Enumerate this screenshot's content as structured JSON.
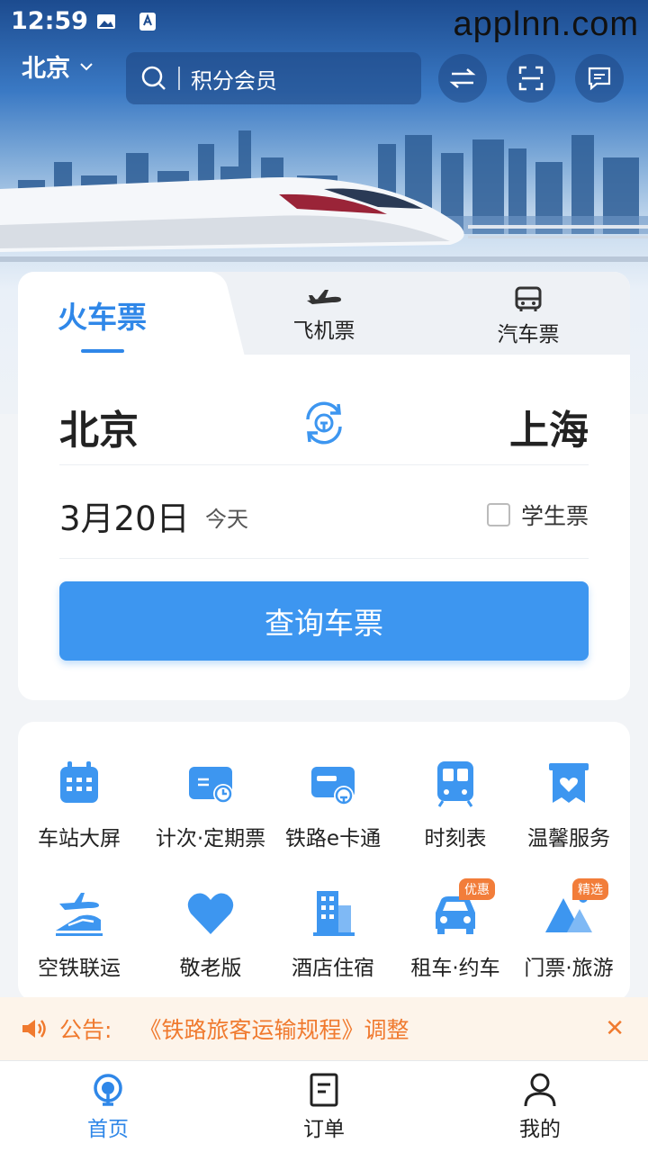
{
  "status_bar": {
    "time": "12:59",
    "watermark": "applnn.com"
  },
  "header": {
    "city": "北京",
    "search_placeholder": "积分会员"
  },
  "ticket_tabs": [
    {
      "label": "火车票",
      "icon": "train-icon"
    },
    {
      "label": "飞机票",
      "icon": "plane-icon"
    },
    {
      "label": "汽车票",
      "icon": "bus-icon"
    }
  ],
  "ticket": {
    "from": "北京",
    "to": "上海",
    "date": "3月20日",
    "day_label": "今天",
    "student_label": "学生票",
    "student_checked": false,
    "query_label": "查询车票"
  },
  "services": [
    {
      "label": "车站大屏",
      "icon": "calendar-icon"
    },
    {
      "label": "计次·定期票",
      "icon": "ticket-card-icon"
    },
    {
      "label": "铁路e卡通",
      "icon": "e-card-icon"
    },
    {
      "label": "时刻表",
      "icon": "timetable-icon"
    },
    {
      "label": "温馨服务",
      "icon": "heart-bag-icon"
    },
    {
      "label": "空铁联运",
      "icon": "air-rail-icon"
    },
    {
      "label": "敬老版",
      "icon": "heart-icon"
    },
    {
      "label": "酒店住宿",
      "icon": "hotel-icon"
    },
    {
      "label": "租车·约车",
      "icon": "car-icon",
      "badge": "优惠"
    },
    {
      "label": "门票·旅游",
      "icon": "mountain-icon",
      "badge": "精选"
    }
  ],
  "notice": {
    "label": "公告:",
    "message": "《铁路旅客运输规程》调整"
  },
  "bottom_nav": [
    {
      "label": "首页",
      "icon": "home-rail-icon",
      "active": true
    },
    {
      "label": "订单",
      "icon": "order-icon"
    },
    {
      "label": "我的",
      "icon": "user-icon"
    }
  ],
  "colors": {
    "primary": "#3d96f0",
    "notice": "#f07a2f"
  }
}
